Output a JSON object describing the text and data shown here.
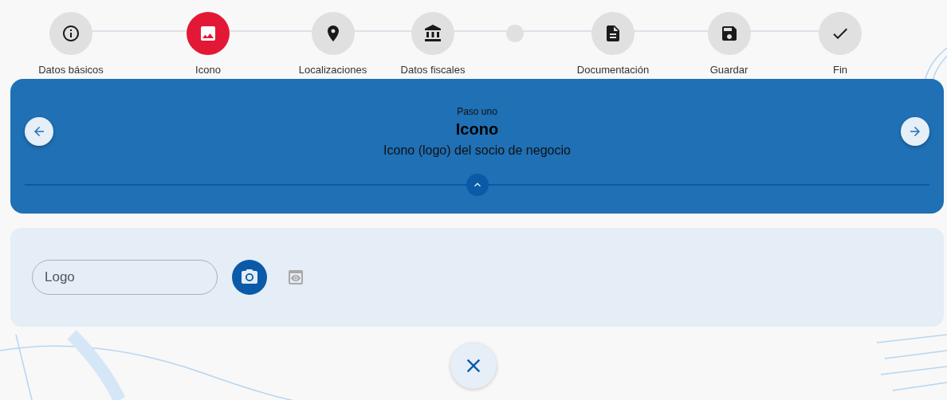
{
  "stepper": [
    {
      "kind": "step",
      "label": "Datos básicos",
      "selected": false
    },
    {
      "kind": "step",
      "label": "Icono",
      "selected": true
    },
    {
      "kind": "step",
      "label": "Localizaciones",
      "selected": false
    },
    {
      "kind": "step",
      "label": "Datos fiscales",
      "selected": false
    },
    {
      "kind": "dot"
    },
    {
      "kind": "step",
      "label": "Documentación",
      "selected": false
    },
    {
      "kind": "step",
      "label": "Guardar",
      "selected": false
    },
    {
      "kind": "step",
      "label": "Fin",
      "selected": false
    }
  ],
  "banner": {
    "eyebrow": "Paso uno",
    "title": "Icono",
    "description": "Icono (logo) del socio de negocio"
  },
  "logo_field": {
    "placeholder": "Logo"
  }
}
